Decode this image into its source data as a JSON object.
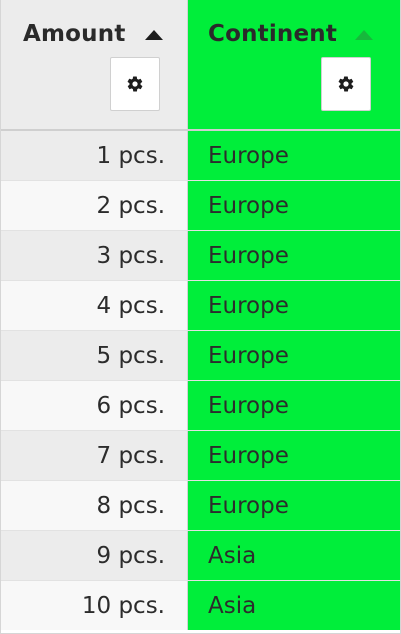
{
  "columns": {
    "amount": {
      "label": "Amount",
      "sort": "ascending",
      "settings_icon": "gear-icon"
    },
    "continent": {
      "label": "Continent",
      "sort": "ascending",
      "settings_icon": "gear-icon"
    }
  },
  "colors": {
    "highlight": "#00ee3a",
    "header_bg": "#ececec",
    "active_sort_arrow": "#17b83c"
  },
  "rows": [
    {
      "amount": "1 pcs.",
      "continent": "Europe"
    },
    {
      "amount": "2 pcs.",
      "continent": "Europe"
    },
    {
      "amount": "3 pcs.",
      "continent": "Europe"
    },
    {
      "amount": "4 pcs.",
      "continent": "Europe"
    },
    {
      "amount": "5 pcs.",
      "continent": "Europe"
    },
    {
      "amount": "6 pcs.",
      "continent": "Europe"
    },
    {
      "amount": "7 pcs.",
      "continent": "Europe"
    },
    {
      "amount": "8 pcs.",
      "continent": "Europe"
    },
    {
      "amount": "9 pcs.",
      "continent": "Asia"
    },
    {
      "amount": "10 pcs.",
      "continent": "Asia"
    }
  ]
}
